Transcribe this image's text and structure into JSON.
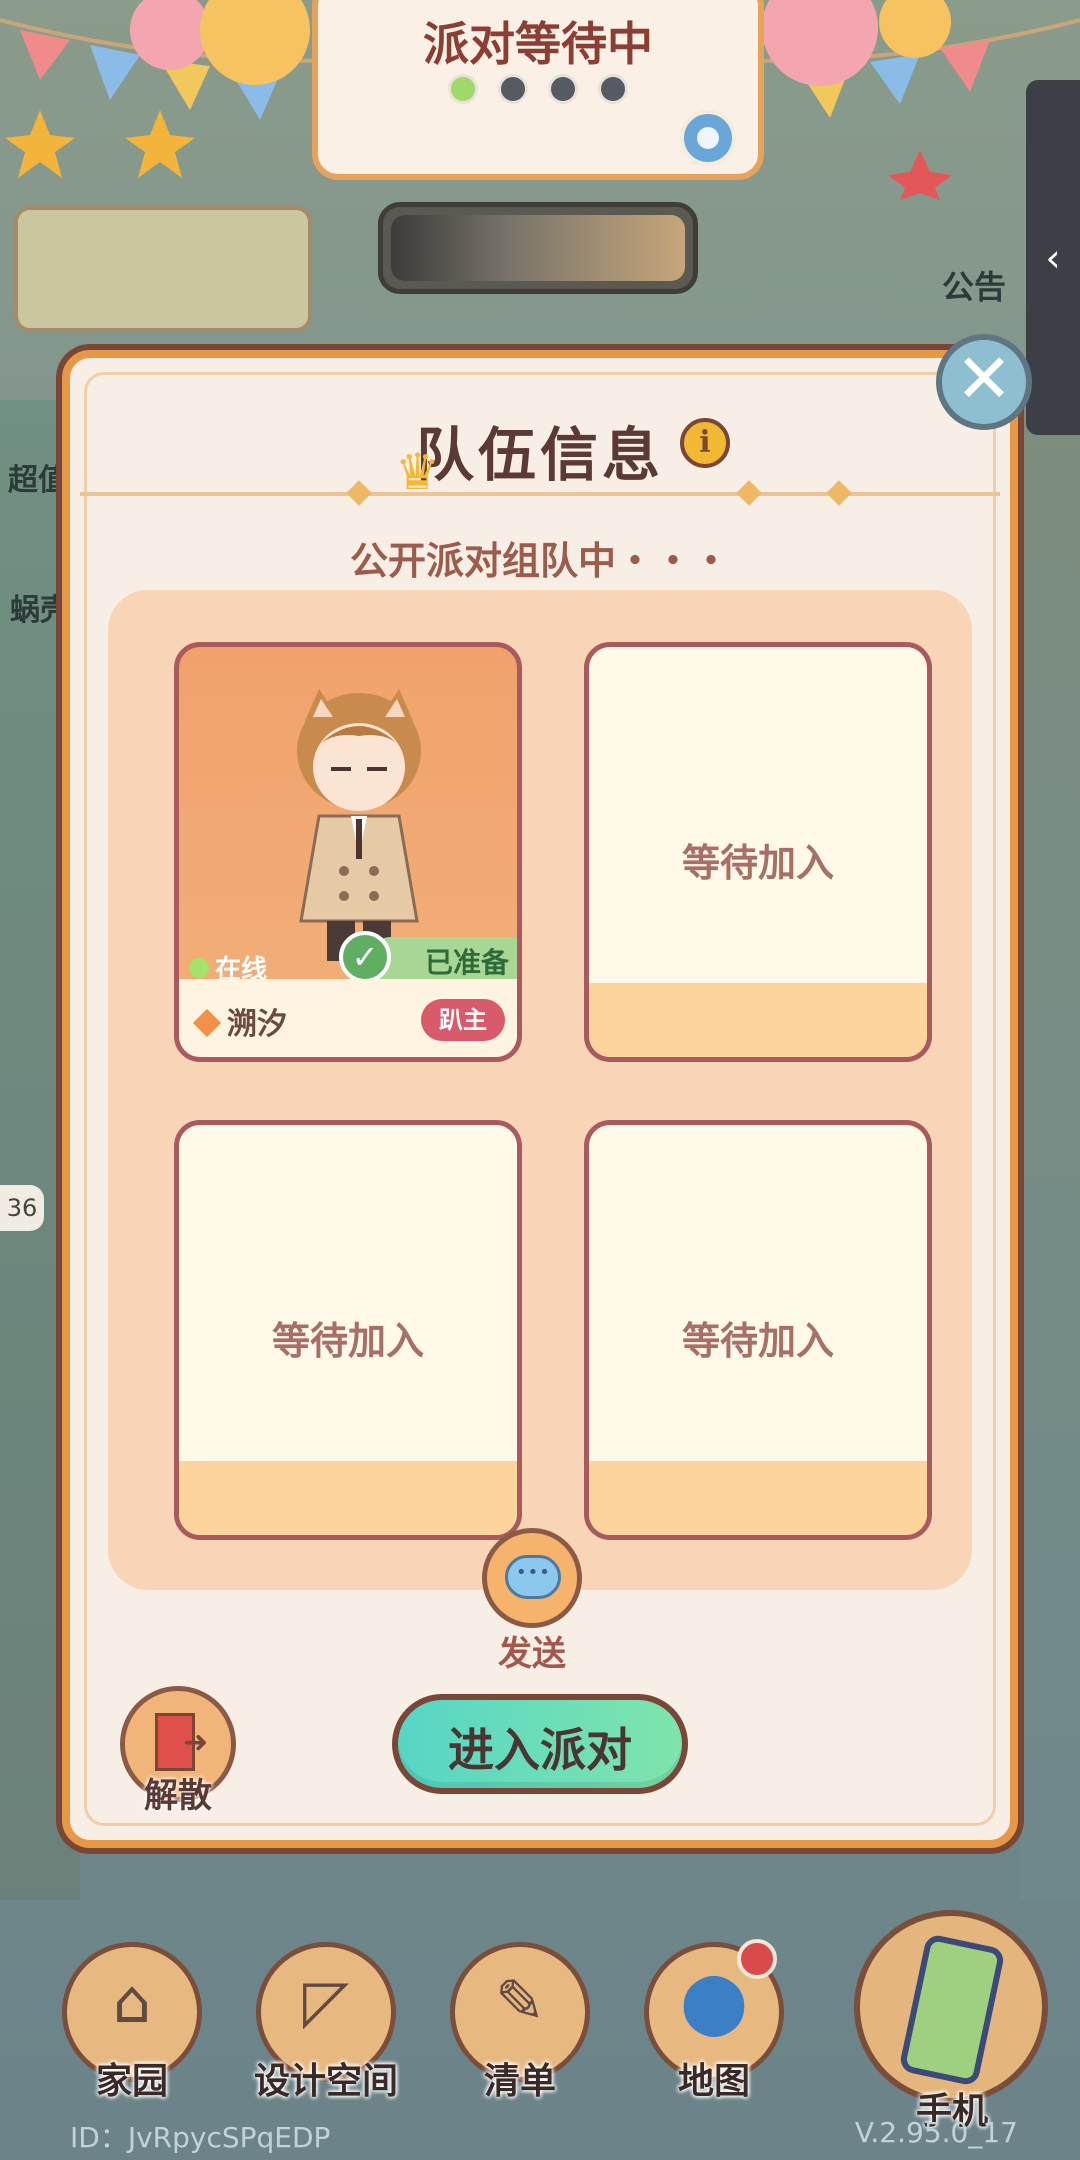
{
  "top_card": {
    "title": "派对等待中",
    "steps_total": 4,
    "steps_done": 1
  },
  "panel": {
    "title": "队伍信息",
    "subtitle": "公开派对组队中・・・",
    "slots": [
      {
        "filled": true,
        "status": "在线",
        "ready": "已准备",
        "name": "溯汐",
        "role": "趴主"
      },
      {
        "filled": false,
        "wait": "等待加入"
      },
      {
        "filled": false,
        "wait": "等待加入"
      },
      {
        "filled": false,
        "wait": "等待加入"
      }
    ],
    "send_label": "发送",
    "disband_label": "解散",
    "enter_label": "进入派对"
  },
  "bottom_nav": [
    {
      "label": "家园",
      "icon": "home-icon"
    },
    {
      "label": "设计空间",
      "icon": "design-icon"
    },
    {
      "label": "清单",
      "icon": "list-icon"
    },
    {
      "label": "地图",
      "icon": "map-icon"
    },
    {
      "label": "手机",
      "icon": "phone-icon"
    }
  ],
  "footer": {
    "id": "ID：JvRpycSPqEDP",
    "version": "V.2.95.0_17"
  },
  "background_text": {
    "left_1": "超值",
    "left_2": "蜗壳",
    "left_3": "36",
    "right_1": "公告"
  },
  "colors": {
    "accent": "#e79847",
    "enter_button": "#56d6c6",
    "host_badge": "#d95a6a"
  }
}
